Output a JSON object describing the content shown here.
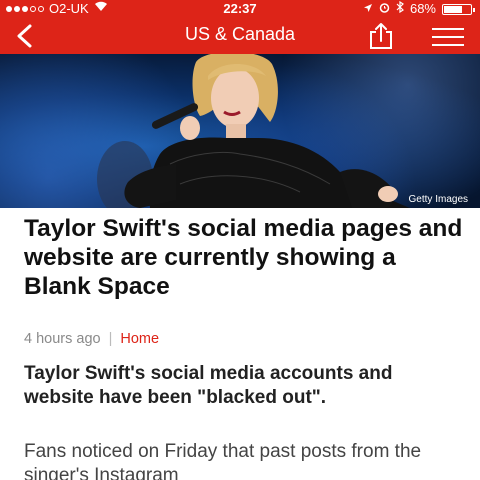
{
  "status_bar": {
    "carrier": "O2-UK",
    "time": "22:37",
    "battery_percent": "68%",
    "battery_level": 0.68
  },
  "nav": {
    "title": "US & Canada",
    "back_icon": "chevron-left-icon",
    "share_icon": "share-icon",
    "menu_icon": "hamburger-menu-icon"
  },
  "hero": {
    "credit": "Getty Images"
  },
  "article": {
    "headline": "Taylor Swift's social media pages and website are currently showing a Blank Space",
    "timestamp": "4 hours ago",
    "separator": "|",
    "section": "Home",
    "summary": "Taylor Swift's social media accounts and website have been \"blacked out\".",
    "body": "Fans noticed on Friday that past posts from the singer's Instagram"
  },
  "colors": {
    "brand_red": "#dd2418"
  }
}
